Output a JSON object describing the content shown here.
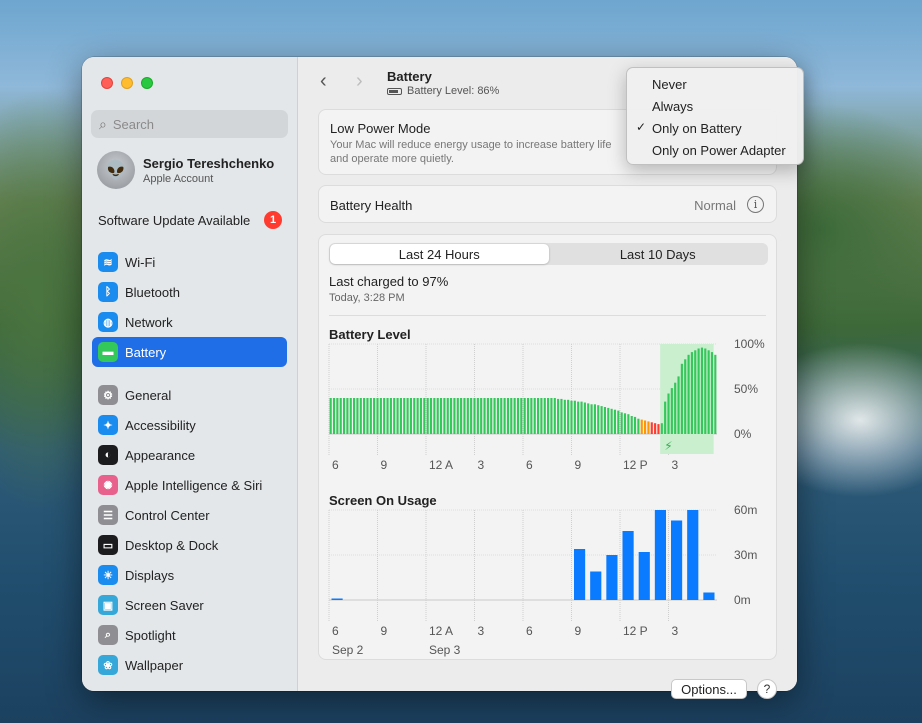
{
  "window": {
    "title": "Battery",
    "subtitle": "Battery Level: 86%"
  },
  "sidebar": {
    "search_placeholder": "Search",
    "account": {
      "name": "Sergio Tereshchenko",
      "subtitle": "Apple Account"
    },
    "update": {
      "label": "Software Update Available",
      "badge": "1"
    },
    "group1": [
      {
        "label": "Wi-Fi",
        "icon": "wifi-icon",
        "color": "#1a8cf0",
        "glyph": "≋"
      },
      {
        "label": "Bluetooth",
        "icon": "bluetooth-icon",
        "color": "#1a8cf0",
        "glyph": "ᛒ"
      },
      {
        "label": "Network",
        "icon": "globe-icon",
        "color": "#1a8cf0",
        "glyph": "◍"
      },
      {
        "label": "Battery",
        "icon": "battery-icon",
        "color": "#34c759",
        "glyph": "▬",
        "active": true
      }
    ],
    "group2": [
      {
        "label": "General",
        "icon": "gear-icon",
        "color": "#8e8e93",
        "glyph": "⚙"
      },
      {
        "label": "Accessibility",
        "icon": "accessibility-icon",
        "color": "#1a8cf0",
        "glyph": "✦"
      },
      {
        "label": "Appearance",
        "icon": "appearance-icon",
        "color": "#1c1c1e",
        "glyph": "◐"
      },
      {
        "label": "Apple Intelligence & Siri",
        "icon": "siri-icon",
        "color": "#e8618c",
        "glyph": "✺"
      },
      {
        "label": "Control Center",
        "icon": "control-center-icon",
        "color": "#8e8e93",
        "glyph": "☰"
      },
      {
        "label": "Desktop & Dock",
        "icon": "dock-icon",
        "color": "#1c1c1e",
        "glyph": "▭"
      },
      {
        "label": "Displays",
        "icon": "displays-icon",
        "color": "#1a8cf0",
        "glyph": "☀"
      },
      {
        "label": "Screen Saver",
        "icon": "screen-saver-icon",
        "color": "#35a7d8",
        "glyph": "▣"
      },
      {
        "label": "Spotlight",
        "icon": "spotlight-icon",
        "color": "#8e8e93",
        "glyph": "⌕"
      },
      {
        "label": "Wallpaper",
        "icon": "wallpaper-icon",
        "color": "#35a7d8",
        "glyph": "❀"
      }
    ]
  },
  "low_power": {
    "title": "Low Power Mode",
    "description": "Your Mac will reduce energy usage to increase battery life and operate more quietly."
  },
  "health": {
    "label": "Battery Health",
    "value": "Normal",
    "info": "i"
  },
  "usage": {
    "tabs": [
      "Last 24 Hours",
      "Last 10 Days"
    ],
    "selected_tab": 0,
    "last_charged": "Last charged to 97%",
    "last_charged_time": "Today, 3:28 PM"
  },
  "menu": {
    "items": [
      "Never",
      "Always",
      "Only on Battery",
      "Only on Power Adapter"
    ],
    "checked": 2,
    "check_glyph": "✓"
  },
  "buttons": {
    "options": "Options...",
    "help": "?"
  },
  "nav": {
    "back": "‹",
    "forward": "›"
  },
  "colors": {
    "accent": "#1f6ee8",
    "battery_green": "#34c759",
    "battery_red": "#ff3b30",
    "usage_blue": "#0a7bff"
  },
  "chart_data": [
    {
      "type": "bar",
      "title": "Battery Level",
      "y_tick_labels": [
        "100%",
        "50%",
        "0%"
      ],
      "ylim": [
        0,
        100
      ],
      "x_tick_labels": [
        "6",
        "9",
        "12 A",
        "3",
        "6",
        "9",
        "12 P",
        "3"
      ],
      "values": [
        40,
        40,
        40,
        40,
        40,
        40,
        40,
        40,
        40,
        40,
        40,
        40,
        40,
        40,
        40,
        40,
        40,
        40,
        40,
        40,
        40,
        40,
        40,
        40,
        40,
        40,
        40,
        40,
        40,
        40,
        40,
        40,
        40,
        40,
        40,
        40,
        40,
        40,
        40,
        40,
        40,
        40,
        40,
        40,
        40,
        40,
        40,
        40,
        40,
        40,
        40,
        40,
        40,
        40,
        40,
        40,
        40,
        40,
        40,
        40,
        40,
        40,
        40,
        40,
        40,
        40,
        40,
        40,
        39,
        39,
        38,
        38,
        37,
        37,
        36,
        36,
        35,
        34,
        33,
        33,
        32,
        31,
        30,
        29,
        28,
        27,
        26,
        24,
        23,
        22,
        20,
        19,
        17,
        16,
        15,
        14,
        13,
        12,
        11,
        12,
        36,
        45,
        51,
        57,
        64,
        78,
        83,
        88,
        91,
        93,
        95,
        96,
        95,
        93,
        91,
        88
      ],
      "low_indices": [
        93,
        94,
        95
      ],
      "critical_indices": [
        96,
        97,
        98
      ],
      "charging_shaded_range": [
        99,
        114
      ],
      "charging_glyph": "⚡",
      "bar_colors": {
        "normal": "#34c759",
        "low": "#ff9500",
        "critical": "#ff3b30"
      }
    },
    {
      "type": "bar",
      "title": "Screen On Usage",
      "y_tick_labels": [
        "60m",
        "30m",
        "0m"
      ],
      "ylim": [
        0,
        60
      ],
      "x_tick_labels": [
        "6",
        "9",
        "12 A",
        "3",
        "6",
        "9",
        "12 P",
        "3"
      ],
      "x_date_labels": [
        "Sep 2",
        "Sep 3"
      ],
      "values": [
        1,
        0,
        0,
        0,
        0,
        0,
        0,
        0,
        0,
        0,
        0,
        0,
        0,
        0,
        0,
        34,
        19,
        30,
        46,
        32,
        60,
        53,
        60,
        5
      ]
    }
  ]
}
